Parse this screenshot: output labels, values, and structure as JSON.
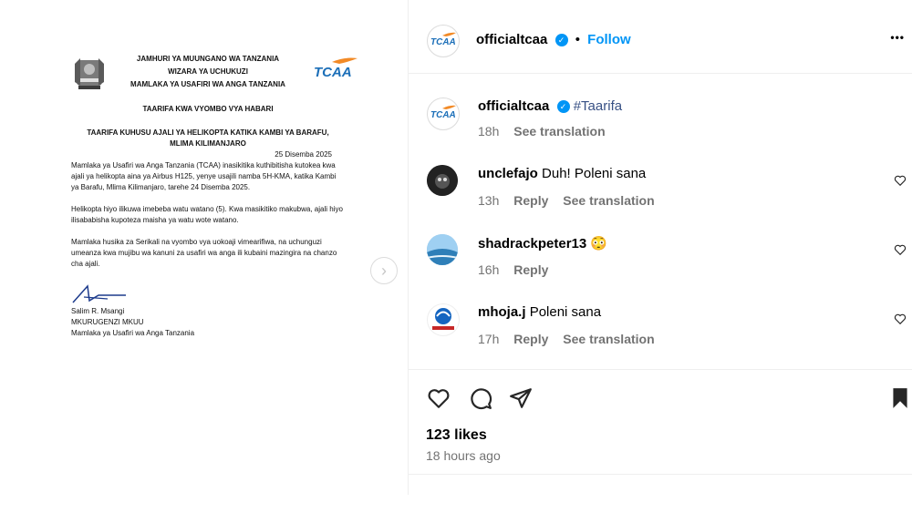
{
  "document": {
    "header_lines": [
      "JAMHURI YA MUUNGANO WA TANZANIA",
      "WIZARA YA UCHUKUZI",
      "MAMLAKA YA USAFIRI WA ANGA TANZANIA"
    ],
    "logo_text": "TCAA",
    "subtitle": "TAARIFA KWA VYOMBO VYA HABARI",
    "headline_1": "TAARIFA KUHUSU AJALI YA HELIKOPTA KATIKA KAMBI YA BARAFU,",
    "headline_2": "MLIMA KILIMANJARO",
    "date": "25 Disemba 2025",
    "para1": "Mamlaka ya Usafiri wa Anga Tanzania (TCAA) inasikitika kuthibitisha kutokea kwa ajali ya helikopta aina ya Airbus H125, yenye usajili namba 5H-KMA, katika Kambi ya Barafu, Mlima Kilimanjaro, tarehe 24 Disemba 2025.",
    "para2": "Helikopta hiyo ilikuwa imebeba watu watano (5). Kwa masikitiko makubwa, ajali hiyo ilisababisha kupoteza maisha ya watu wote watano.",
    "para3": "Mamlaka husika za Serikali na vyombo vya uokoaji vimearifiwa, na uchunguzi umeanza kwa mujibu wa kanuni za usafiri wa anga ili kubaini mazingira na chanzo cha ajali.",
    "signer_name": "Salim R. Msangi",
    "signer_title": "MKURUGENZI MKUU",
    "signer_org": "Mamlaka ya Usafiri wa Anga Tanzania"
  },
  "post": {
    "account": "officialtcaa",
    "follow_label": "Follow",
    "separator": "•",
    "more_label": "•••",
    "caption_hashtag": "#Taarifa",
    "caption_age": "18h",
    "see_translation": "See translation",
    "likes": "123 likes",
    "posted": "18 hours ago"
  },
  "comments": [
    {
      "user": "unclefajo",
      "text": "Duh! Poleni sana",
      "age": "13h",
      "reply": "Reply",
      "translate": "See translation"
    },
    {
      "user": "shadrackpeter13",
      "text": "😳",
      "age": "16h",
      "reply": "Reply",
      "translate": ""
    },
    {
      "user": "mhoja.j",
      "text": "Poleni sana",
      "age": "17h",
      "reply": "Reply",
      "translate": "See translation"
    }
  ],
  "colors": {
    "link_blue": "#385185",
    "verified_blue": "#0095f6",
    "muted": "#737373",
    "tcaa_blue": "#1c6fb8",
    "tcaa_orange": "#f28a26"
  },
  "icons": {
    "like": "heart-icon",
    "comment": "comment-icon",
    "share": "share-icon",
    "save": "bookmark-icon",
    "next": "chevron-right-icon"
  }
}
